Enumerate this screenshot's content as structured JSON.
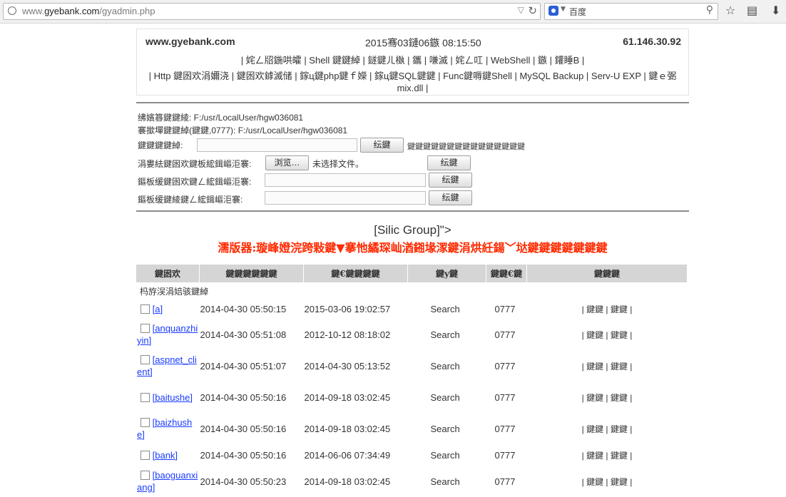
{
  "browser": {
    "url_prefix": "www.",
    "url_domain": "gyebank.com",
    "url_path": "/gyadmin.php",
    "search_placeholder": "百度"
  },
  "header": {
    "site": "www.gyebank.com",
    "date": "2015骞03鏈06鏃 08:15:50",
    "ip": "61.146.30.92",
    "nav1": [
      "| 姹ㄥ牊鍦哄皬",
      "| Shell 鍵鍵綽",
      "| 鐩鍵ㄦ槸",
      "| 鑴",
      "| 嗛滅",
      "| 姹ㄥ叿",
      "| WebShell",
      "| 鏃",
      "| 鑵睡B",
      "|"
    ],
    "nav2_text": "| Http 鍵囦欢涓嬭浇 | 鍵囦欢鎼滅储 | 鎵ц鍵php鍵ｆ嬫 | 鎵ц鍵SQL鍵鍵 | Func鍵嗕鍵Shell | MySQL Backup | Serv-U EXP | 鍵ｅ弻 mix.dll |"
  },
  "info": {
    "line1": "绋嬪簭鍵鍵綾: F:/usr/LocalUser/hgw036081",
    "line2": "褰撳墠鍵鍵綽(鍵鍵,0777): F:/usr/LocalUser/hgw036081",
    "row3_label": "鍵鍵鍵鍵綽:",
    "row3_btn": "纭鍵",
    "row3_note": "鍵鍵鍵鍵鍵鍵鍵鍵鍵鍵鍵鍵鍵鍵鍵",
    "row4_label": "涓婁紶鍵囦欢鍵板綋鍓嶇洰褰:",
    "row4_browse": "浏览…",
    "row4_nofile": "未选择文件。",
    "row4_btn": "纭鍵",
    "row5_label": "鏂板缓鍵囦欢鍵ㄥ綋鍓嶇洰褰:",
    "row5_btn": "纭鍵",
    "row6_label": "鏂板缓鍵綾鍵ㄥ綋鍓嶇洰褰:",
    "row6_btn": "纭鍵"
  },
  "group": {
    "title": "[Silic Group]\">",
    "subtitle": "濡版器:璇峰嬁浣跨敤鍵▼搴忚繘琛屾湭鎺堟潈鍵涓烘紝鍚﹀垯鍵鍵鍵鍵鍵鍵鍵"
  },
  "table": {
    "headers": [
      "鍵囦欢",
      "鍵鍵鍵鍵鍵鍵",
      "鍵€鍵鍵鍵鍵",
      "鍵y鍵",
      "鍵鍵€鍵",
      "鍵鍵鍵"
    ],
    "parent_row": "杩斿洖涓婄骇鍵綽",
    "rows": [
      {
        "name": "[a]",
        "created": "2014-04-30 05:50:15",
        "modified": "2015-03-06 19:02:57",
        "action": "Search",
        "perm": "0777",
        "ops": "| 鍵鍵 | 鍵鍵 |"
      },
      {
        "name": "[anquanzhiyin]",
        "created": "2014-04-30 05:51:08",
        "modified": "2012-10-12 08:18:02",
        "action": "Search",
        "perm": "0777",
        "ops": "| 鍵鍵 | 鍵鍵 |"
      },
      {
        "name": "[aspnet_client]",
        "created": "2014-04-30 05:51:07",
        "modified": "2014-04-30 05:13:52",
        "action": "Search",
        "perm": "0777",
        "ops": "| 鍵鍵 | 鍵鍵 |"
      },
      {
        "name": "[baitushe]",
        "created": "2014-04-30 05:50:16",
        "modified": "2014-09-18 03:02:45",
        "action": "Search",
        "perm": "0777",
        "ops": "| 鍵鍵 | 鍵鍵 |"
      },
      {
        "name": "[baizhushe]",
        "created": "2014-04-30 05:50:16",
        "modified": "2014-09-18 03:02:45",
        "action": "Search",
        "perm": "0777",
        "ops": "| 鍵鍵 | 鍵鍵 |"
      },
      {
        "name": "[bank]",
        "created": "2014-04-30 05:50:16",
        "modified": "2014-06-06 07:34:49",
        "action": "Search",
        "perm": "0777",
        "ops": "| 鍵鍵 | 鍵鍵 |"
      },
      {
        "name": "[baoguanxiang]",
        "created": "2014-04-30 05:50:23",
        "modified": "2014-09-18 03:02:45",
        "action": "Search",
        "perm": "0777",
        "ops": "| 鍵鍵 | 鍵鍵 |"
      }
    ]
  }
}
